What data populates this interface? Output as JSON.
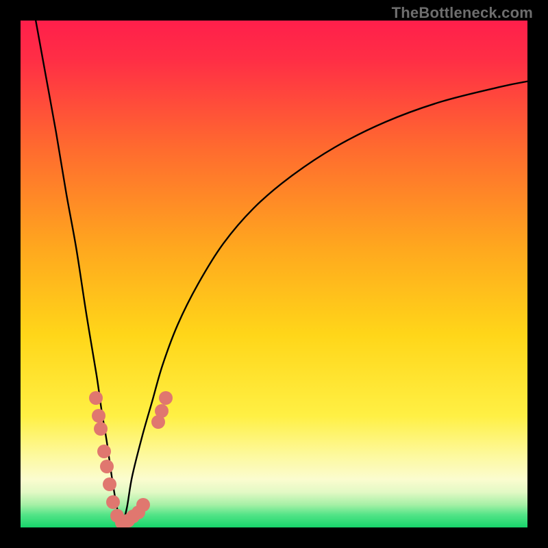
{
  "watermark": "TheBottleneck.com",
  "chart_data": {
    "type": "line",
    "title": "",
    "xlabel": "",
    "ylabel": "",
    "xlim": [
      0,
      100
    ],
    "ylim": [
      0,
      100
    ],
    "x_min_marker": 20,
    "gradient_stops": [
      {
        "pos": 0,
        "color": "#ff1f4b"
      },
      {
        "pos": 0.08,
        "color": "#ff2f45"
      },
      {
        "pos": 0.25,
        "color": "#ff6a2f"
      },
      {
        "pos": 0.45,
        "color": "#ffa81e"
      },
      {
        "pos": 0.62,
        "color": "#ffd619"
      },
      {
        "pos": 0.78,
        "color": "#fff044"
      },
      {
        "pos": 0.86,
        "color": "#fdf9a0"
      },
      {
        "pos": 0.905,
        "color": "#fbfccf"
      },
      {
        "pos": 0.93,
        "color": "#e3f9c5"
      },
      {
        "pos": 0.955,
        "color": "#a6f0a6"
      },
      {
        "pos": 0.975,
        "color": "#53e487"
      },
      {
        "pos": 1.0,
        "color": "#17d46b"
      }
    ],
    "series": [
      {
        "name": "left-branch",
        "x": [
          3,
          5,
          7,
          9,
          11,
          13,
          15,
          16,
          17,
          18,
          19,
          20
        ],
        "y": [
          100,
          89,
          78,
          66,
          55,
          42,
          30,
          23,
          17,
          10,
          4,
          0
        ]
      },
      {
        "name": "right-branch",
        "x": [
          20,
          21,
          22,
          24,
          26,
          28,
          31,
          35,
          40,
          46,
          53,
          62,
          72,
          83,
          95,
          100
        ],
        "y": [
          0,
          4,
          10,
          18,
          25,
          32,
          40,
          48,
          56,
          63,
          69,
          75,
          80,
          84,
          87,
          88
        ]
      }
    ],
    "markers": {
      "name": "data-points",
      "color": "#e0776f",
      "radius_px": 10,
      "points": [
        {
          "x": 14.8,
          "y": 25.5
        },
        {
          "x": 15.4,
          "y": 22.0
        },
        {
          "x": 15.8,
          "y": 19.5
        },
        {
          "x": 16.5,
          "y": 15.0
        },
        {
          "x": 17.0,
          "y": 12.0
        },
        {
          "x": 17.6,
          "y": 8.5
        },
        {
          "x": 18.2,
          "y": 5.0
        },
        {
          "x": 19.0,
          "y": 2.3
        },
        {
          "x": 20.0,
          "y": 0.9
        },
        {
          "x": 21.2,
          "y": 1.3
        },
        {
          "x": 22.2,
          "y": 2.1
        },
        {
          "x": 23.2,
          "y": 3.0
        },
        {
          "x": 24.2,
          "y": 4.5
        },
        {
          "x": 27.2,
          "y": 20.8
        },
        {
          "x": 27.8,
          "y": 23.0
        },
        {
          "x": 28.6,
          "y": 25.5
        }
      ]
    }
  }
}
